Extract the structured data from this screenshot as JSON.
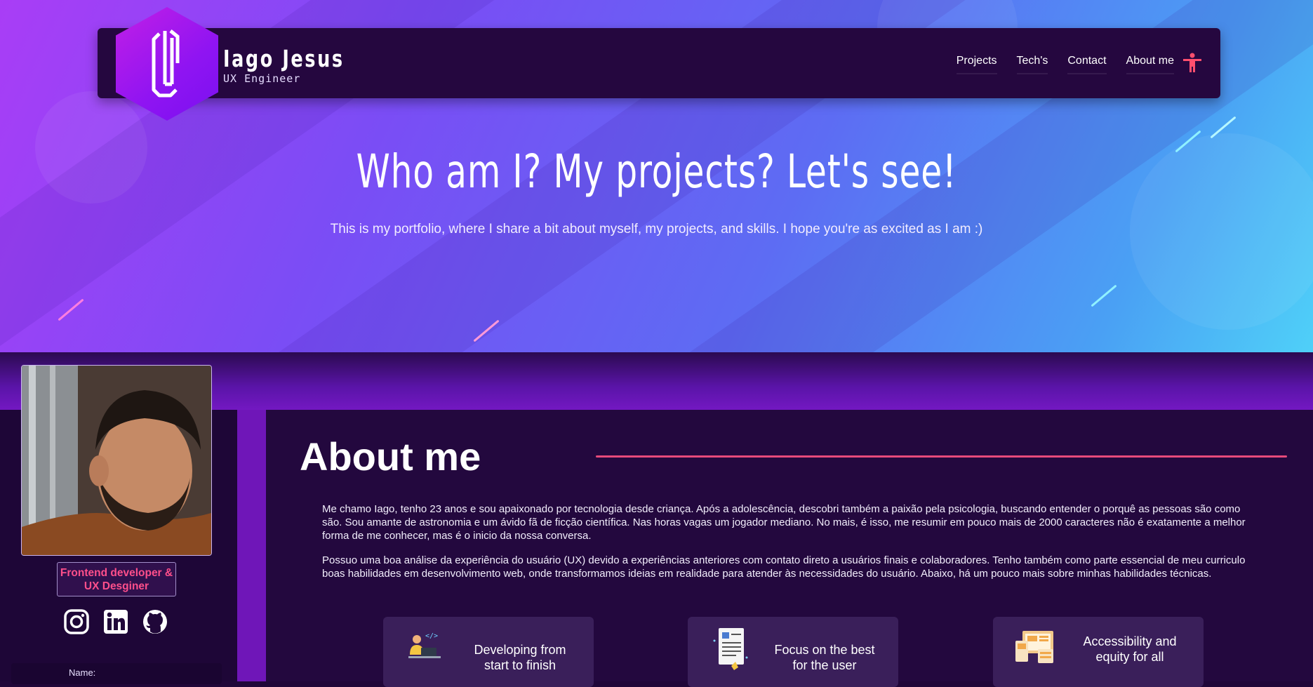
{
  "brand": {
    "name": "Iago Jesus",
    "subtitle": "UX Engineer"
  },
  "nav": {
    "links": [
      "Projects",
      "Tech's",
      "Contact",
      "About me"
    ],
    "accessibility_icon": "accessibility-person-icon"
  },
  "hero": {
    "title": "Who am I? My projects? Let's see!",
    "subtitle": "This is my portfolio, where I share a bit about myself, my projects, and skills. I hope you're as excited as I am :)"
  },
  "profile": {
    "role_line1": "Frontend developer &",
    "role_line2": "UX Desginer",
    "socials": [
      "instagram-icon",
      "linkedin-icon",
      "github-icon"
    ],
    "name_label": "Name:"
  },
  "about": {
    "title": "About me",
    "paragraph1": "Me chamo Iago, tenho 23 anos e sou apaixonado por tecnologia desde criança. Após a adolescência, descobri também a paixão pela psicologia, buscando entender o porquê as pessoas são como são. Sou amante de astronomia e um ávido fã de ficção científica. Nas horas vagas um jogador mediano. No mais, é isso, me resumir em pouco mais de 2000 caracteres não é exatamente a melhor forma de me conhecer, mas é o inicio da nossa conversa.",
    "paragraph2": "Possuo uma boa análise da experiência do usuário (UX) devido a experiências anteriores com contato direto a usuários finais e colaboradores. Tenho também como parte essencial de meu curriculo boas habilidades em desenvolvimento web, onde transformamos ideias em realidade para atender às necessidades do usuário. Abaixo, há um pouco mais sobre minhas habilidades técnicas."
  },
  "cards": [
    {
      "line1": "Developing from",
      "line2": "start to finish",
      "icon": "developer-at-laptop-icon"
    },
    {
      "line1": "Focus on the best",
      "line2": "for the user",
      "icon": "document-checklist-icon"
    },
    {
      "line1": "Accessibility and",
      "line2": "equity for all",
      "icon": "devices-layout-icon"
    }
  ],
  "colors": {
    "accent": "#e64a7b",
    "role_text": "#ff4f8b",
    "panel": "#23083e",
    "nav": "#25073f"
  }
}
